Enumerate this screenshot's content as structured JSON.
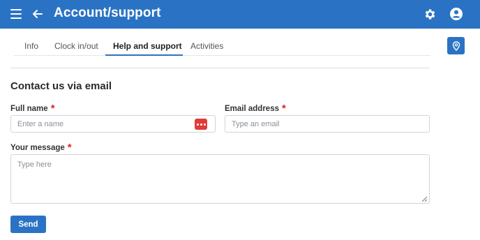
{
  "appbar": {
    "title": "Account/support",
    "icons": [
      "hamburger-menu-icon",
      "back-arrow-icon",
      "gear-icon",
      "account-circle-icon"
    ],
    "color": "#2a73c4"
  },
  "tabs": [
    {
      "label": "Info",
      "active": false
    },
    {
      "label": "Clock in/out",
      "active": false
    },
    {
      "label": "Help and support",
      "active": true
    },
    {
      "label": "Activities",
      "active": false
    }
  ],
  "location_button": {
    "icon": "map-pin-icon"
  },
  "form": {
    "title": "Contact us via email",
    "required_mark": "*",
    "full_name": {
      "label": "Full name",
      "placeholder": "Enter a name",
      "value": ""
    },
    "email": {
      "label": "Email address",
      "placeholder": "Type an email",
      "value": ""
    },
    "message": {
      "label": "Your message",
      "placeholder": "Type here",
      "value": ""
    },
    "send_label": "Send"
  },
  "colors": {
    "accent": "#2a73c4",
    "required": "#e02424",
    "badge": "#e03a3a"
  }
}
